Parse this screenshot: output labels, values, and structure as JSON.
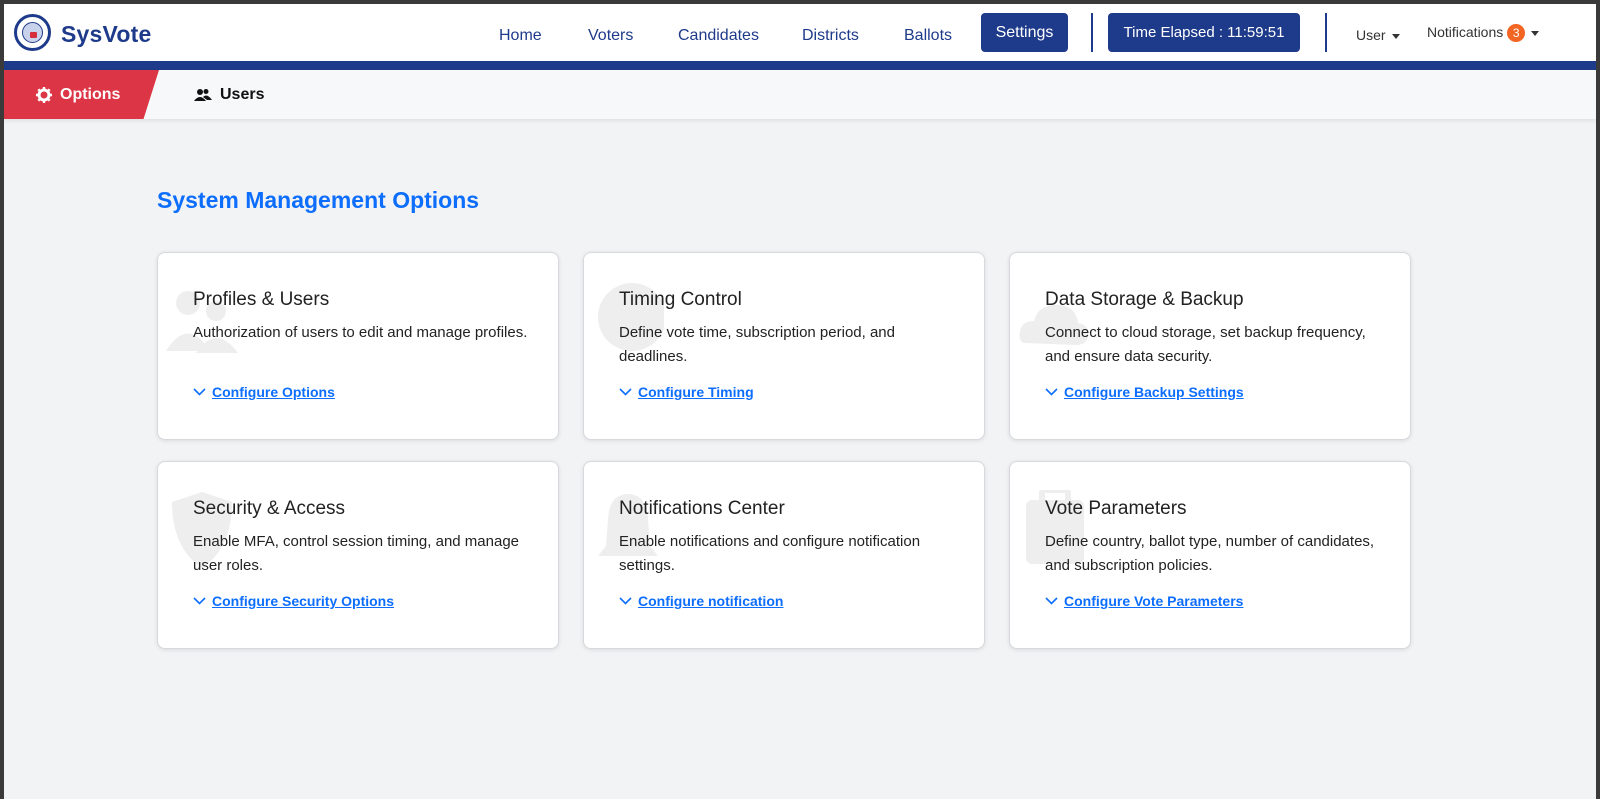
{
  "app": {
    "brand": "SysVote"
  },
  "nav": {
    "links": [
      "Home",
      "Voters",
      "Candidates",
      "Districts",
      "Ballots"
    ],
    "settings": "Settings",
    "timer": "Time Elapsed : 11:59:51",
    "user": "User",
    "notifications": "Notifications",
    "notification_count": "3"
  },
  "tabs": {
    "options": "Options",
    "users": "Users"
  },
  "main": {
    "title": "System Management Options",
    "cards": [
      {
        "title": "Profiles & Users",
        "desc": "Authorization of users to edit and manage profiles.",
        "link": "Configure Options",
        "icon": "users-icon"
      },
      {
        "title": "Timing Control",
        "desc": "Define vote time, subscription period, and deadlines.",
        "link": "Configure Timing",
        "icon": "clock-icon"
      },
      {
        "title": "Data Storage & Backup",
        "desc": "Connect to cloud storage, set backup frequency, and ensure data security.",
        "link": "Configure Backup Settings",
        "icon": "cloud-icon"
      },
      {
        "title": "Security & Access",
        "desc": "Enable MFA, control session timing, and manage user roles.",
        "link": "Configure Security Options",
        "icon": "shield-icon"
      },
      {
        "title": "Notifications Center",
        "desc": "Enable notifications and configure notification settings.",
        "link": "Configure notification",
        "icon": "bell-icon"
      },
      {
        "title": "Vote Parameters",
        "desc": "Define country, ballot type, number of candidates, and subscription policies.",
        "link": "Configure Vote Parameters",
        "icon": "ballot-icon"
      }
    ]
  },
  "colors": {
    "primary": "#1e3a8a",
    "accent": "#dc3545",
    "link": "#0d6efd",
    "badge": "#f26522"
  }
}
